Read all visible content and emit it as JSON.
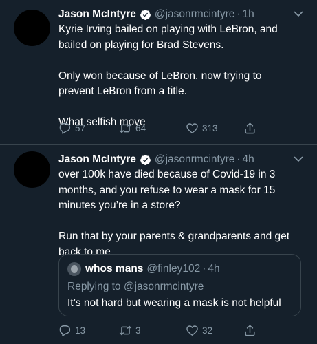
{
  "colors": {
    "background": "#15202b",
    "secondary_text": "#8899a6",
    "divider": "#38444d",
    "verified_badge": "#ffffff"
  },
  "tweets": [
    {
      "author_name": "Jason McIntyre",
      "handle": "@jasonrmcintyre",
      "separator": "·",
      "time": "1h",
      "verified": true,
      "text": "Kyrie Irving bailed on playing with LeBron, and\nbailed on playing for Brad Stevens.\n\nOnly won because of LeBron, now trying to\nprevent LeBron from a title.\n\nWhat selfish move",
      "replies": "57",
      "retweets": "64",
      "likes": "313"
    },
    {
      "author_name": "Jason McIntyre",
      "handle": "@jasonrmcintyre",
      "separator": "·",
      "time": "4h",
      "verified": true,
      "text": "over 100k have died because of Covid-19 in 3\nmonths, and you refuse to wear a mask for 15\nminutes you’re in a store?\n\nRun that by your parents & grandparents and get\nback to me",
      "quote": {
        "author_name": "whos mans",
        "handle": "@finley102",
        "separator": "·",
        "time": "4h",
        "replying_to_label": "Replying to",
        "replying_to_handle": "@jasonrmcintyre",
        "text": "It’s not hard but wearing a mask is not helpful"
      },
      "replies": "13",
      "retweets": "3",
      "likes": "32"
    }
  ]
}
